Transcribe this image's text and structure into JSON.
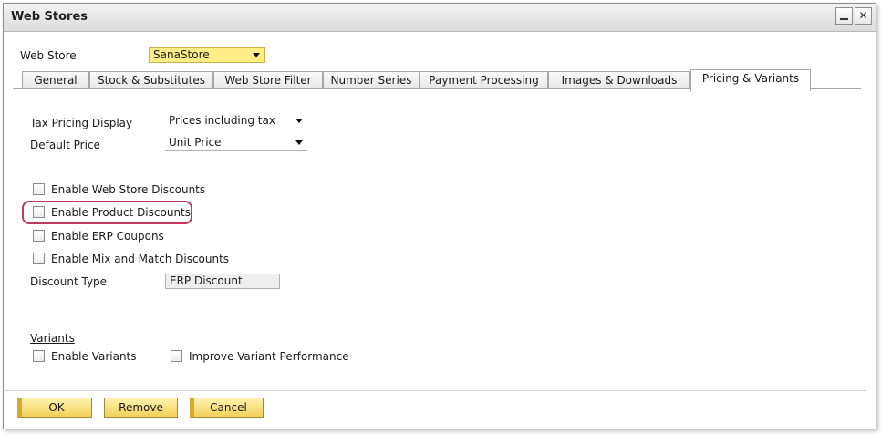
{
  "window": {
    "title": "Web Stores"
  },
  "web_store": {
    "label": "Web Store",
    "value": "SanaStore"
  },
  "tabs": [
    {
      "label": "General"
    },
    {
      "label": "Stock & Substitutes"
    },
    {
      "label": "Web Store Filter"
    },
    {
      "label": "Number Series"
    },
    {
      "label": "Payment Processing"
    },
    {
      "label": "Images & Downloads"
    },
    {
      "label": "Pricing & Variants",
      "active": true
    }
  ],
  "pricing": {
    "tax_label": "Tax Pricing Display",
    "tax_value": "Prices including tax",
    "default_label": "Default Price",
    "default_value": "Unit Price"
  },
  "discounts": {
    "web_store": "Enable Web Store Discounts",
    "product": "Enable Product Discounts",
    "erp_coupons": "Enable ERP Coupons",
    "mix_match": "Enable Mix and Match Discounts",
    "type_label": "Discount Type",
    "type_value": "ERP Discount"
  },
  "variants": {
    "section_title": "Variants",
    "enable": "Enable Variants",
    "improve": "Improve Variant Performance"
  },
  "buttons": {
    "ok": "OK",
    "remove": "Remove",
    "cancel": "Cancel"
  },
  "colors": {
    "highlight_ring": "#c0385a",
    "button_fill": "#f2cf59",
    "dropdown_yellow": "#ffee88"
  }
}
